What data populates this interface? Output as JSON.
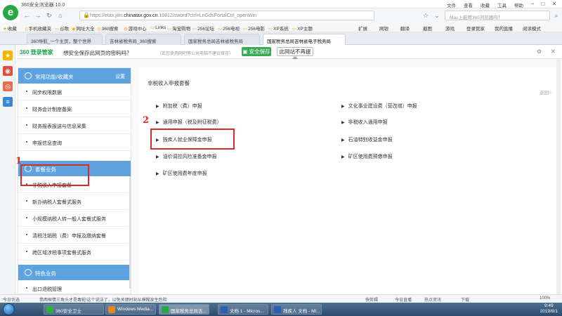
{
  "window": {
    "title": "360安全浏览器 10.0",
    "menu": [
      "文件",
      "查看",
      "收藏",
      "工具",
      "帮助"
    ],
    "controls": [
      "−",
      "□",
      "✕"
    ]
  },
  "address": {
    "url_prefix": "https://etax.jilin.",
    "url_domain": "chinatax.gov.cn",
    "url_suffix": ":10812/sword?ctrl=LnGdsPortalCtrl_openWin",
    "search_placeholder": "Mac上能用360浏览器吗！"
  },
  "bookmarks": {
    "left": [
      "收藏",
      "手机收藏夹",
      "谷歌",
      "网址大全",
      "360搜索",
      "游戏中心",
      "Links",
      "淘宝购物",
      "256论坛",
      "256电视",
      "256电影",
      "XP系统",
      "XP主题"
    ],
    "right": [
      "扩展",
      "网银",
      "翻译",
      "截图",
      "游戏",
      "登录管家",
      "我的直播",
      "阅读模式"
    ]
  },
  "tabs": [
    "360导航_一个主页，整个世界",
    "吉林省税务局_360搜索",
    "国家税务总局吉林省税务局",
    "国家税务总局吉林省电子税务局"
  ],
  "security": {
    "brand": "360 登录管家",
    "question": "想安全保存此网页的密码吗？",
    "note": "（若您使用网吧等公共电脑不建议保存）",
    "save_label": "安全保存",
    "no_remind_label": "此网站不再提示"
  },
  "sidebar": {
    "sections": [
      {
        "title": "常用功能/收藏夹",
        "action": "设置",
        "items": [
          "同步权限数据",
          "财务会计制度备案",
          "财务报表报送与信息采集",
          "申报信息查询"
        ]
      },
      {
        "title": "套餐业务",
        "action": "",
        "items": [
          "非税收入申报套餐",
          "新办纳税人套餐式服务",
          "小规模纳税人转一般人套餐式服务",
          "清税注销税（费）申报及缴纳套餐",
          "跨区域涉税事项套餐式服务"
        ]
      },
      {
        "title": "特色业务",
        "action": "",
        "items": [
          "出口退税管理"
        ]
      }
    ]
  },
  "main": {
    "heading": "非税收入申报套餐",
    "back": "返回>",
    "left_items": [
      "附加税（费）申报",
      "通用申报（税及附征税费）",
      "残疾人就业保障金申报",
      "油价调控风险准备金申报",
      "矿区使用费年度申报"
    ],
    "right_items": [
      "文化事业建设费（营改增）申报",
      "非税收入通用申报",
      "石油特别收益金申报",
      "矿区使用费预缴申报"
    ]
  },
  "annotations": {
    "mark1": "1",
    "mark2": "2"
  },
  "status": {
    "left": "今日优选",
    "news": "翡两框情三角头才是毒蛇!这个说法了，以免关键时刻从模糊发生危险",
    "right": [
      "快剪辑",
      "今日直播",
      "热点资讯",
      "下载",
      "100%"
    ]
  },
  "taskbar": {
    "apps": [
      "360安全卫士",
      "Windows Media...",
      "国家税务总局吉...",
      "文档 1 - Micros...",
      "残疾人 文档 - MI..."
    ],
    "time": "9:49",
    "date": "2019/8/1"
  }
}
